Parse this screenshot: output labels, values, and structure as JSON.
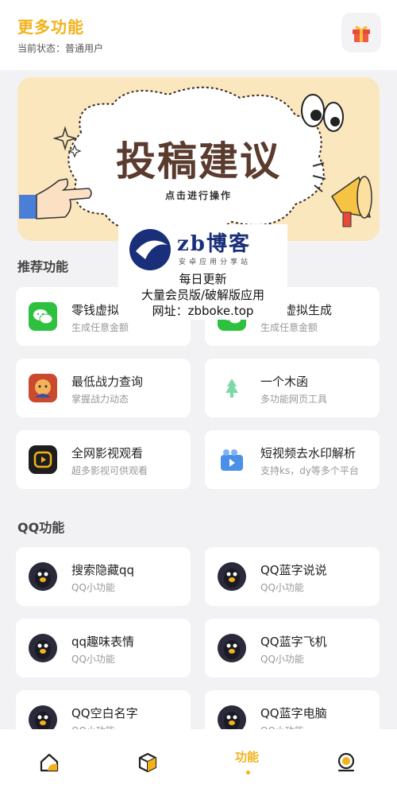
{
  "header": {
    "title": "更多功能",
    "status_label": "当前状态：普通用户",
    "gift_icon": "gift-icon"
  },
  "banner": {
    "title": "投稿建议",
    "subtitle": "点击进行操作"
  },
  "watermark": {
    "brand": "zb博客",
    "slogan": "安卓应用分享站",
    "line1": "每日更新",
    "line2": "大量会员版/破解版应用",
    "line3": "网址：zbboke.top"
  },
  "sections": {
    "recommend": "推荐功能",
    "qq": "QQ功能"
  },
  "recommend_items": [
    {
      "title": "零钱虚拟生成",
      "desc": "生成任意金额",
      "icon": "wechat-icon"
    },
    {
      "title": "账单虚拟生成",
      "desc": "生成任意金额",
      "icon": "wechat-icon"
    },
    {
      "title": "最低战力查询",
      "desc": "掌握战力动态",
      "icon": "game-icon"
    },
    {
      "title": "一个木函",
      "desc": "多功能网页工具",
      "icon": "tree-icon"
    },
    {
      "title": "全网影视观看",
      "desc": "超多影视可供观看",
      "icon": "play-icon"
    },
    {
      "title": "短视频去水印解析",
      "desc": "支持ks，dy等多个平台",
      "icon": "video-icon"
    }
  ],
  "qq_items": [
    {
      "title": "搜索隐藏qq",
      "desc": "QQ小功能",
      "icon": "qq-penguin-icon"
    },
    {
      "title": "QQ蓝字说说",
      "desc": "QQ小功能",
      "icon": "qq-penguin-icon"
    },
    {
      "title": "qq趣味表情",
      "desc": "QQ小功能",
      "icon": "qq-penguin-icon"
    },
    {
      "title": "QQ蓝字飞机",
      "desc": "QQ小功能",
      "icon": "qq-penguin-icon"
    },
    {
      "title": "QQ空白名字",
      "desc": "QQ小功能",
      "icon": "qq-penguin-icon"
    },
    {
      "title": "QQ蓝字电脑",
      "desc": "QQ小功能",
      "icon": "qq-penguin-icon"
    }
  ],
  "bottom_nav": {
    "active_label": "功能",
    "items": [
      "home-icon",
      "cube-icon",
      "function-tab",
      "profile-icon"
    ]
  },
  "colors": {
    "accent": "#f2b21b",
    "background": "#f2f2f4",
    "card": "#ffffff"
  }
}
